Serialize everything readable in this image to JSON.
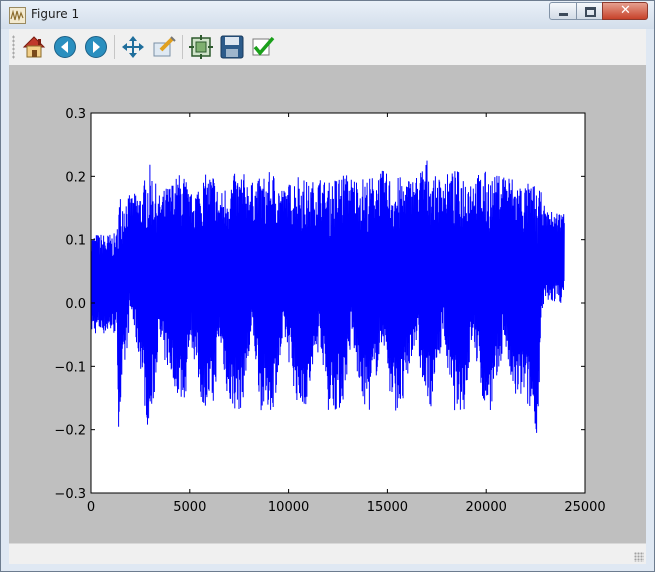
{
  "window": {
    "title": "Figure 1",
    "close_glyph": "✕"
  },
  "toolbar": {
    "buttons": [
      {
        "name": "home-button",
        "icon": "home-icon"
      },
      {
        "name": "back-button",
        "icon": "arrow-left-icon"
      },
      {
        "name": "forward-button",
        "icon": "arrow-right-icon"
      },
      {
        "name": "pan-button",
        "icon": "move-icon"
      },
      {
        "name": "zoom-button",
        "icon": "zoom-rect-icon"
      },
      {
        "name": "configure-subplots-button",
        "icon": "subplots-icon"
      },
      {
        "name": "save-button",
        "icon": "floppy-disk-icon"
      },
      {
        "name": "edit-parameters-button",
        "icon": "checkmark-icon"
      }
    ]
  },
  "colors": {
    "line": "#0000ff",
    "canvas_bg": "#bfbfbf",
    "axes_bg": "#ffffff"
  },
  "chart_data": {
    "type": "line",
    "title": "",
    "xlabel": "",
    "ylabel": "",
    "xlim": [
      0,
      25000
    ],
    "ylim": [
      -0.3,
      0.3
    ],
    "grid": false,
    "xticks": [
      0,
      5000,
      10000,
      15000,
      20000,
      25000
    ],
    "xtick_labels": [
      "0",
      "5000",
      "10000",
      "15000",
      "20000",
      "25000"
    ],
    "yticks": [
      -0.3,
      -0.2,
      -0.1,
      0.0,
      0.1,
      0.2,
      0.3
    ],
    "ytick_labels": [
      "−0.3",
      "−0.2",
      "−0.1",
      "0.0",
      "0.1",
      "0.2",
      "0.3"
    ],
    "series": [
      {
        "color": "#0000ff",
        "n_samples": 24000,
        "envelope": {
          "x": [
            0,
            1300,
            1400,
            2000,
            2600,
            2800,
            3000,
            3200,
            3400,
            4600,
            4800,
            5000,
            5600,
            6200,
            6500,
            7000,
            7600,
            8200,
            8600,
            9200,
            9800,
            10500,
            11000,
            11600,
            12000,
            12700,
            13200,
            13700,
            14100,
            14800,
            15200,
            15800,
            16400,
            17000,
            17300,
            17800,
            18300,
            18900,
            19300,
            19900,
            20400,
            20900,
            21400,
            21900,
            22400,
            22600,
            22800,
            23000,
            23500,
            23950
          ],
          "max": [
            0.11,
            0.11,
            0.175,
            0.17,
            0.18,
            0.21,
            0.22,
            0.2,
            0.17,
            0.21,
            0.2,
            0.17,
            0.2,
            0.21,
            0.17,
            0.2,
            0.21,
            0.19,
            0.2,
            0.21,
            0.18,
            0.21,
            0.19,
            0.2,
            0.19,
            0.21,
            0.2,
            0.2,
            0.2,
            0.21,
            0.2,
            0.2,
            0.2,
            0.23,
            0.2,
            0.2,
            0.21,
            0.21,
            0.2,
            0.21,
            0.2,
            0.21,
            0.2,
            0.19,
            0.19,
            0.18,
            0.175,
            0.145,
            0.145,
            0.145
          ],
          "min": [
            -0.05,
            -0.05,
            -0.2,
            -0.02,
            -0.12,
            -0.19,
            -0.2,
            -0.15,
            -0.07,
            -0.16,
            -0.15,
            -0.05,
            -0.16,
            -0.17,
            -0.06,
            -0.17,
            -0.17,
            -0.06,
            -0.17,
            -0.17,
            -0.06,
            -0.17,
            -0.16,
            -0.06,
            -0.17,
            -0.17,
            -0.06,
            -0.16,
            -0.17,
            -0.06,
            -0.17,
            -0.17,
            -0.06,
            -0.17,
            -0.16,
            -0.05,
            -0.17,
            -0.17,
            -0.06,
            -0.17,
            -0.17,
            -0.06,
            -0.16,
            -0.15,
            -0.19,
            -0.21,
            -0.04,
            0.0,
            0.0,
            0.0
          ]
        }
      }
    ]
  }
}
